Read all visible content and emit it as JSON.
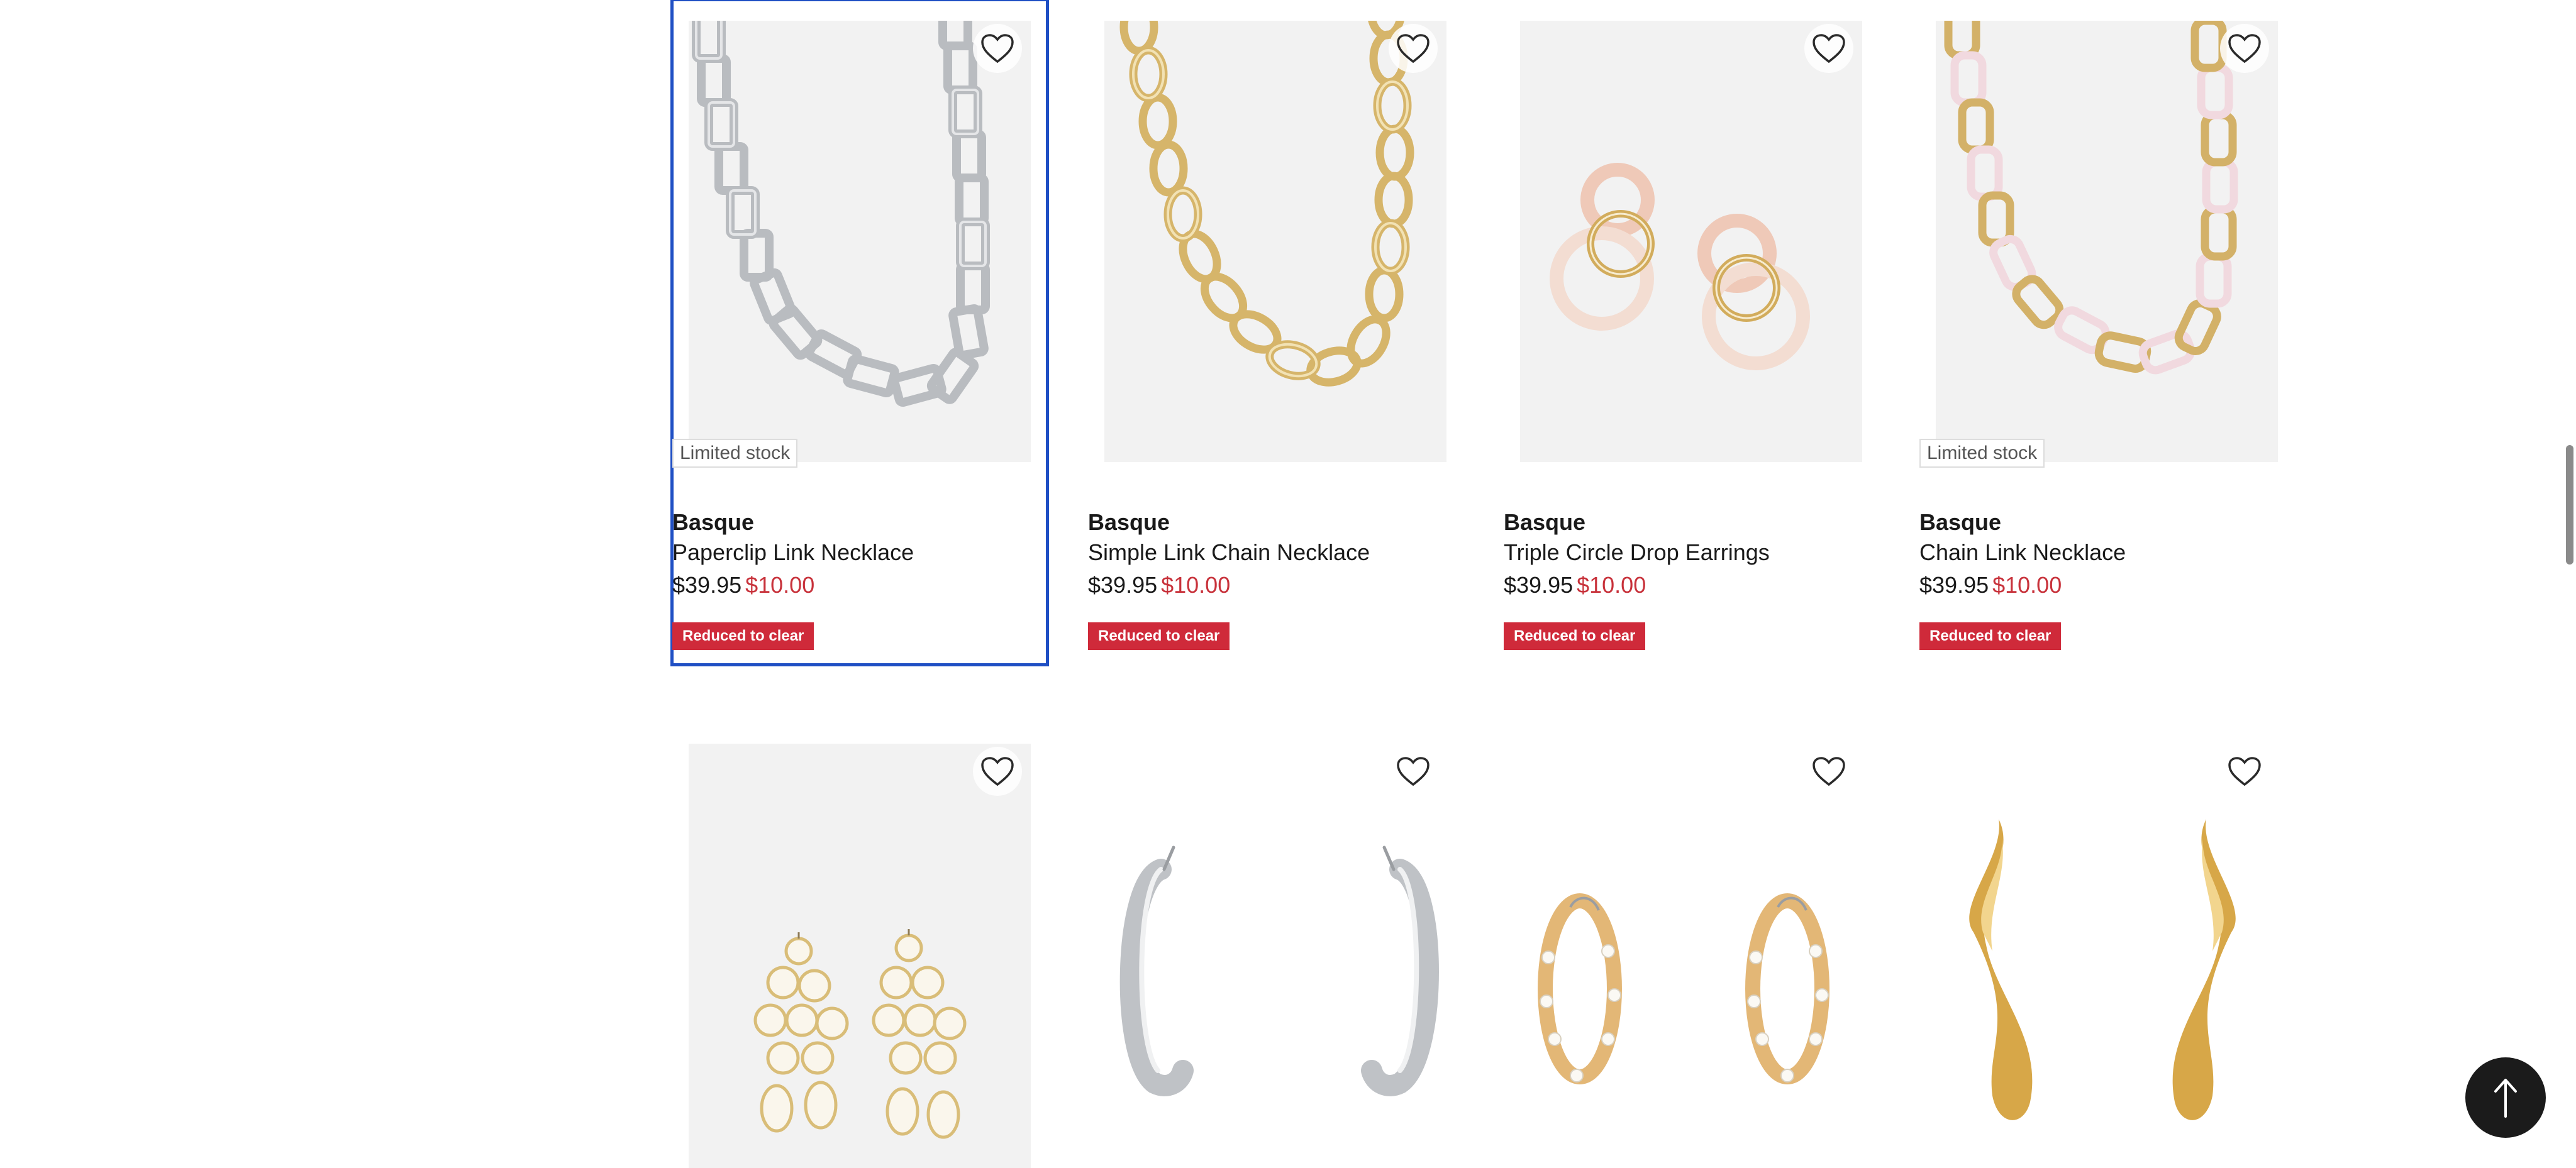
{
  "products": [
    {
      "brand": "Basque",
      "name": "Paperclip Link Necklace",
      "was_price": "$39.95",
      "now_price": "$10.00",
      "badge": "Limited stock",
      "promo": "Reduced to clear",
      "wishlist_icon": "heart-outline-icon"
    },
    {
      "brand": "Basque",
      "name": "Simple Link Chain Necklace",
      "was_price": "$39.95",
      "now_price": "$10.00",
      "badge": "",
      "promo": "Reduced to clear",
      "wishlist_icon": "heart-outline-icon"
    },
    {
      "brand": "Basque",
      "name": "Triple Circle Drop Earrings",
      "was_price": "$39.95",
      "now_price": "$10.00",
      "badge": "",
      "promo": "Reduced to clear",
      "wishlist_icon": "heart-outline-icon"
    },
    {
      "brand": "Basque",
      "name": "Chain Link Necklace",
      "was_price": "$39.95",
      "now_price": "$10.00",
      "badge": "Limited stock",
      "promo": "Reduced to clear",
      "wishlist_icon": "heart-outline-icon"
    },
    {
      "wishlist_icon": "heart-outline-icon"
    },
    {
      "wishlist_icon": "heart-outline-icon"
    },
    {
      "wishlist_icon": "heart-outline-icon"
    },
    {
      "wishlist_icon": "heart-outline-icon"
    }
  ],
  "back_to_top_icon": "arrow-up-icon",
  "colors": {
    "focus_outline": "#1f4fc4",
    "sale_price": "#c8323b",
    "promo_badge": "#cf2a3a",
    "back_to_top": "#1b1b1b"
  }
}
